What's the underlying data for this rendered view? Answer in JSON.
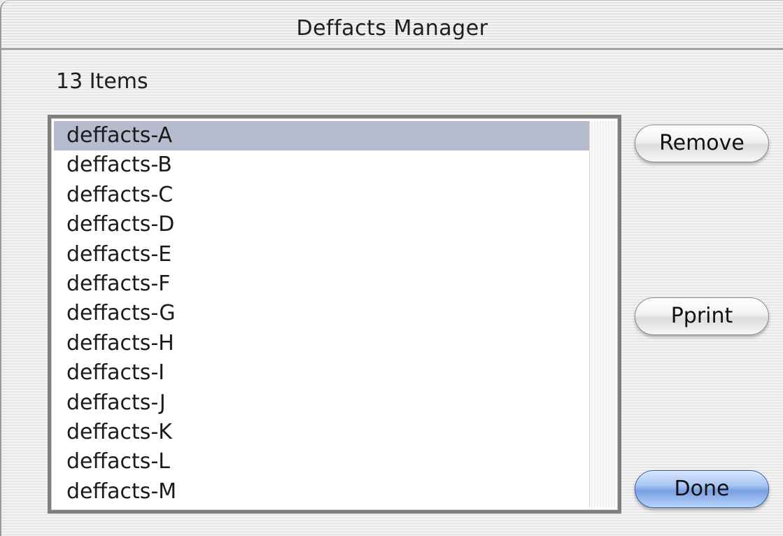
{
  "window": {
    "title": "Deffacts Manager"
  },
  "item_count_label": "13 Items",
  "list": {
    "selected_index": 0,
    "items": [
      "deffacts-A",
      "deffacts-B",
      "deffacts-C",
      "deffacts-D",
      "deffacts-E",
      "deffacts-F",
      "deffacts-G",
      "deffacts-H",
      "deffacts-I",
      "deffacts-J",
      "deffacts-K",
      "deffacts-L",
      "deffacts-M"
    ]
  },
  "buttons": {
    "remove": "Remove",
    "pprint": "Pprint",
    "done": "Done"
  },
  "colors": {
    "selection": "#b6bcce",
    "default_button": "#7aa0e2"
  }
}
